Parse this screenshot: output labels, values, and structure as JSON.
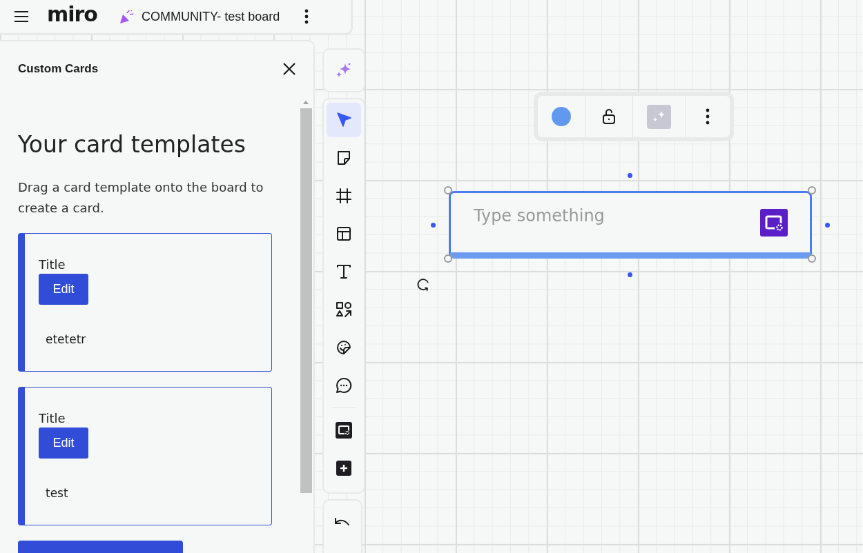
{
  "top_bar": {
    "logo": "miro",
    "board_name": "COMMUNITY- test board"
  },
  "panel": {
    "title": "Custom Cards",
    "heading": "Your card templates",
    "description": "Drag a card template onto the board to create a card.",
    "templates": [
      {
        "title": "Title",
        "button": "Edit",
        "body": "etetetr"
      },
      {
        "title": "Title",
        "button": "Edit",
        "body": "test"
      }
    ]
  },
  "toolbar": {
    "tools": [
      {
        "kind": "select",
        "selected": true
      },
      {
        "kind": "sticky",
        "selected": false
      },
      {
        "kind": "frame",
        "selected": false
      },
      {
        "kind": "layout",
        "selected": false
      },
      {
        "kind": "text",
        "selected": false
      },
      {
        "kind": "shapes",
        "selected": false
      },
      {
        "kind": "sticker",
        "selected": false
      },
      {
        "kind": "comment",
        "selected": false
      }
    ],
    "app_tools": [
      {
        "kind": "cards",
        "selected": false
      },
      {
        "kind": "add",
        "selected": false
      }
    ]
  },
  "canvas_card": {
    "placeholder": "Type something"
  }
}
